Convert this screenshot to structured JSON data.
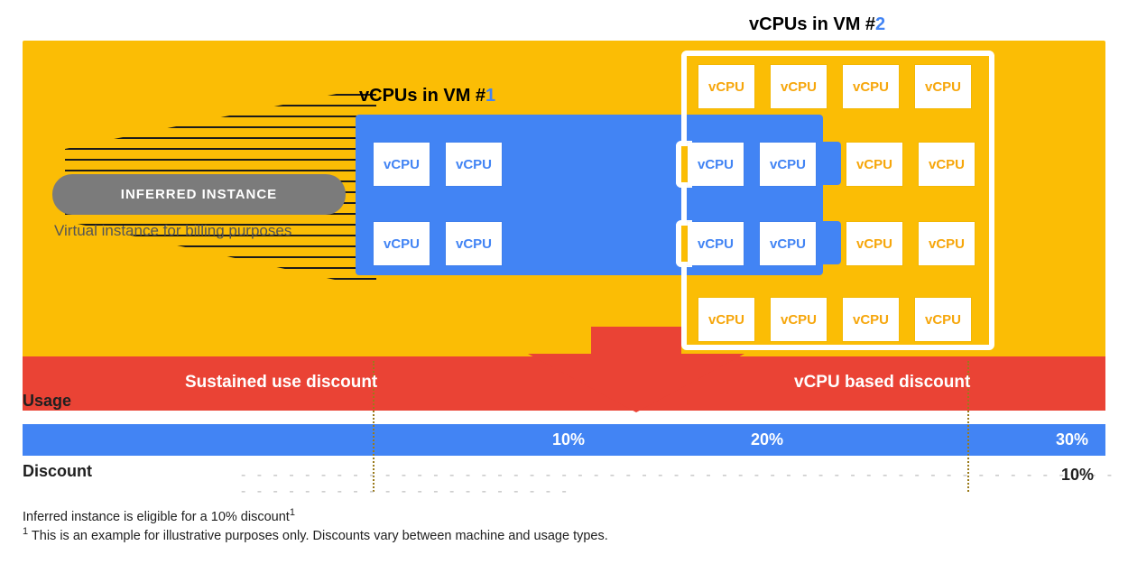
{
  "vm": {
    "label_prefix": "vCPUs in VM #",
    "a_num": "1",
    "b_num": "2",
    "tile": "vCPU"
  },
  "pill": {
    "title": "INFERRED INSTANCE",
    "subtitle": "Virtual instance for billing purposes"
  },
  "red": {
    "left": "Sustained use discount",
    "right": "vCPU based discount"
  },
  "rows": {
    "usage": "Usage",
    "discount": "Discount"
  },
  "pct": {
    "p10": "10%",
    "p20": "20%",
    "p30": "30%"
  },
  "discount": {
    "lead": "- - - - - - - - - - - - - - - - - - - - - - - - - - - - - - - - - - - - - - - - - - - - - - - - - - - - - - - - - - - - - - - - - - - - - - - - - - - -",
    "d10": "10%"
  },
  "foot": {
    "l1": "Inferred instance is eligible for a 10% discount",
    "l1_sup": "1",
    "l2_sup": "1",
    "l2": " This is an example for illustrative purposes only. Discounts vary between machine and usage types."
  }
}
